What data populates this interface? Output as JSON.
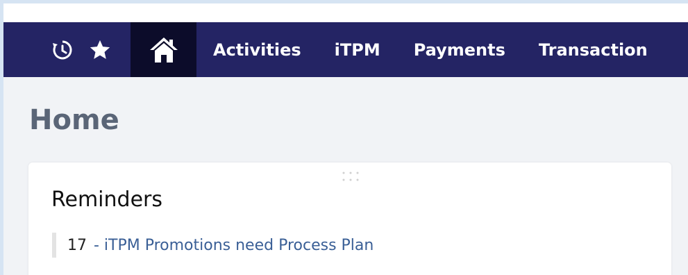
{
  "colors": {
    "background": "#d6e4f3",
    "navbar": "#242464",
    "navbar_active": "#0c0c2a",
    "page_bg": "#f1f3f6",
    "title": "#5a6577",
    "link": "#3a5f96"
  },
  "navbar": {
    "icons": [
      "history-icon",
      "star-icon",
      "home-icon"
    ],
    "active": "home",
    "links": [
      {
        "label": "Activities"
      },
      {
        "label": "iTPM"
      },
      {
        "label": "Payments"
      },
      {
        "label": "Transaction"
      }
    ]
  },
  "page": {
    "title": "Home"
  },
  "reminders": {
    "title": "Reminders",
    "items": [
      {
        "count": "17",
        "text": "- iTPM Promotions need Process Plan"
      }
    ]
  }
}
